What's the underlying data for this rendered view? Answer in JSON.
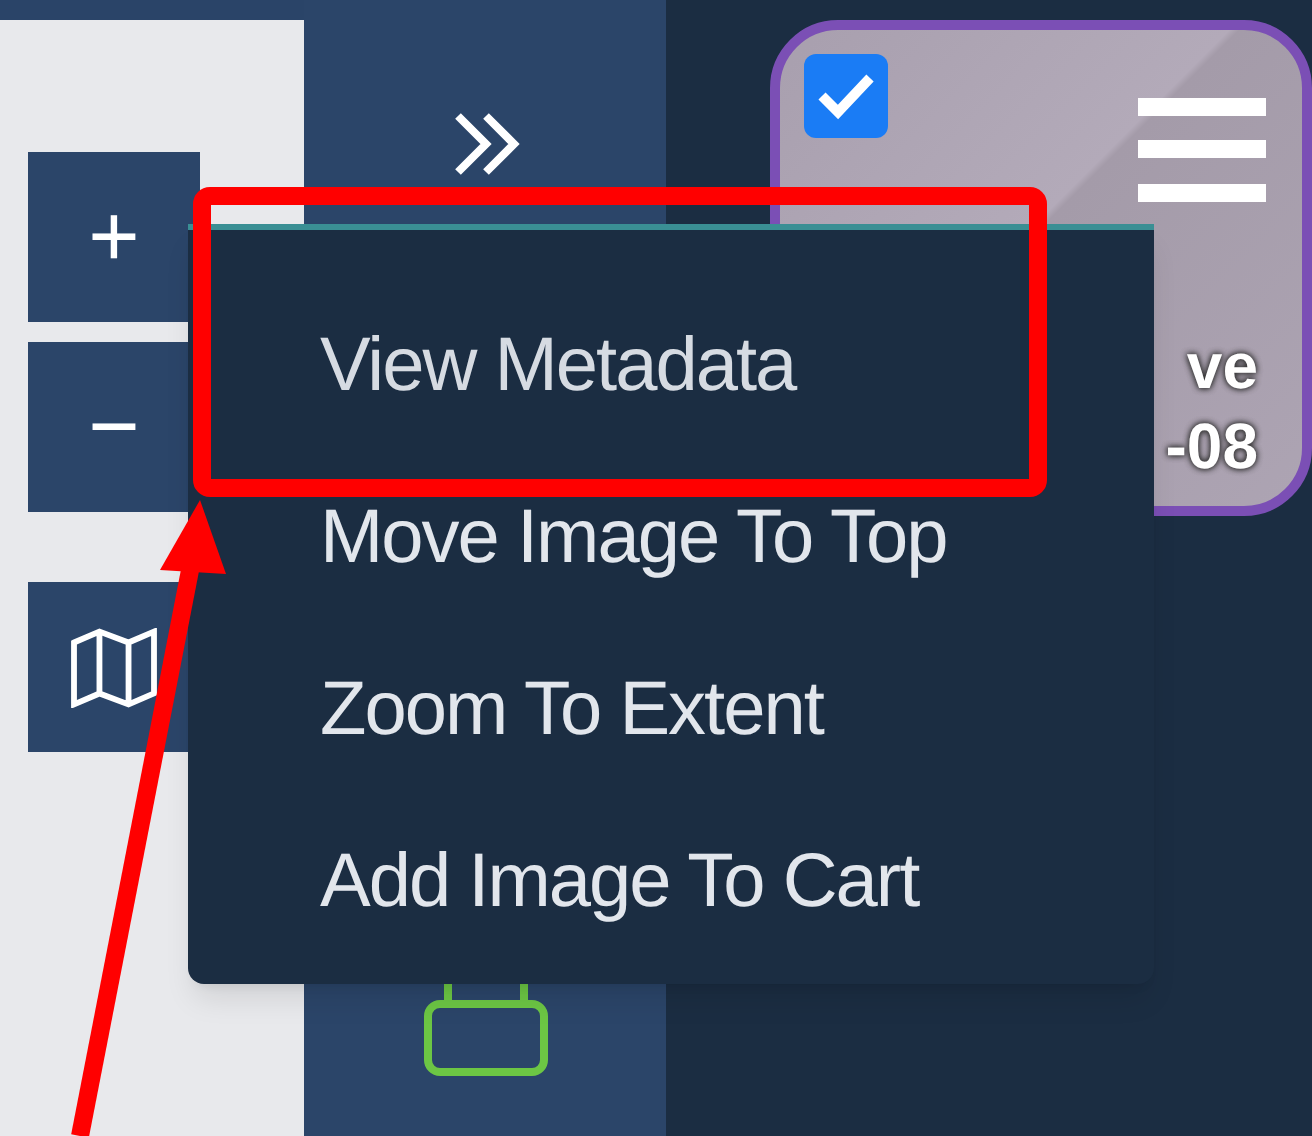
{
  "map_controls": {
    "zoom_in": "+",
    "zoom_out": "−"
  },
  "image_card": {
    "checked": true,
    "label_lines": [
      "ve",
      "-08"
    ]
  },
  "context_menu": {
    "items": [
      {
        "label": "View Metadata",
        "selected": true
      },
      {
        "label": "Move Image To Top",
        "selected": false
      },
      {
        "label": "Zoom To Extent",
        "selected": false
      },
      {
        "label": "Add Image To Cart",
        "selected": false
      }
    ]
  }
}
